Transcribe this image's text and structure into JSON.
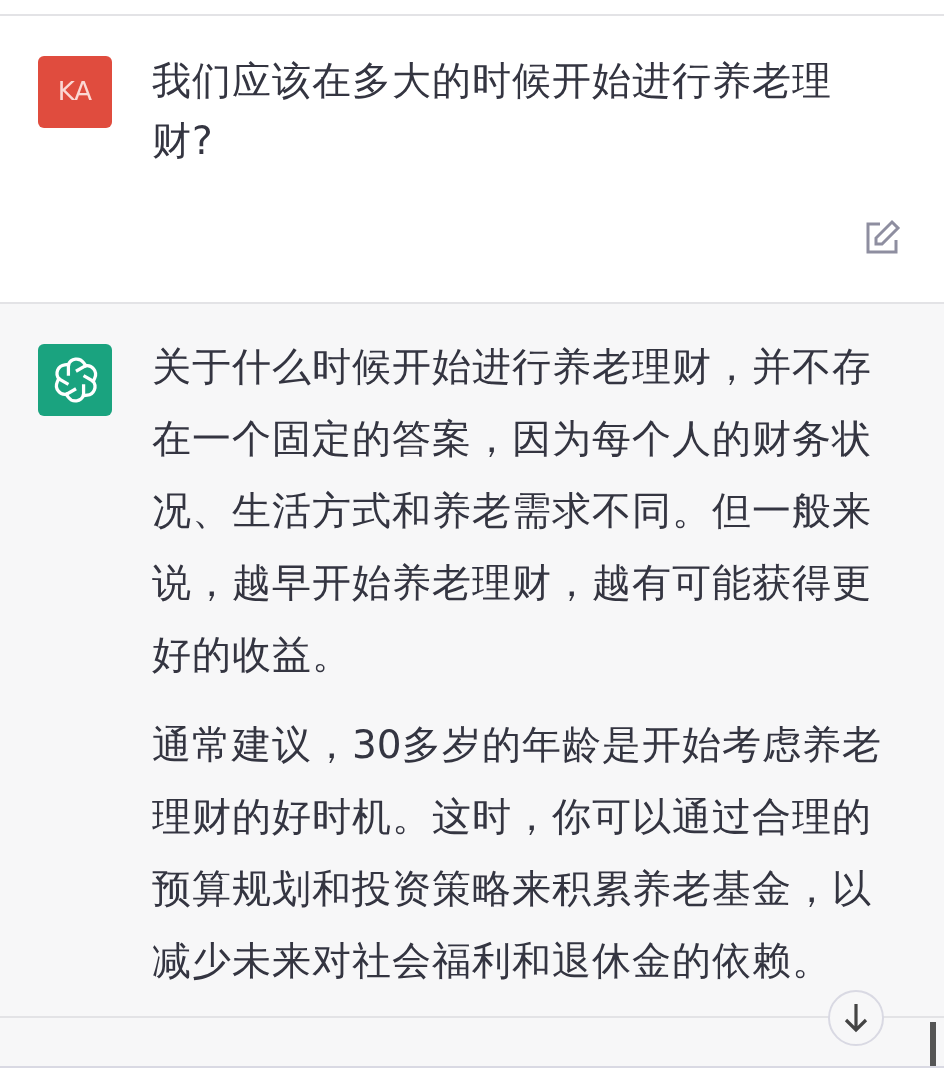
{
  "messages": [
    {
      "kind": "user",
      "avatar": "KA",
      "paragraphs": [
        "我们应该在多大的时候开始进行养老理财?"
      ]
    },
    {
      "kind": "assistant",
      "paragraphs": [
        "关于什么时候开始进行养老理财，并不存在一个固定的答案，因为每个人的财务状况、生活方式和养老需求不同。但一般来说，越早开始养老理财，越有可能获得更好的收益。",
        "通常建议，30多岁的年龄是开始考虑养老理财的好时机。这时，你可以通过合理的预算规划和投资策略来积累养老基金，以减少未来对社会福利和退休金的依赖。"
      ]
    }
  ]
}
